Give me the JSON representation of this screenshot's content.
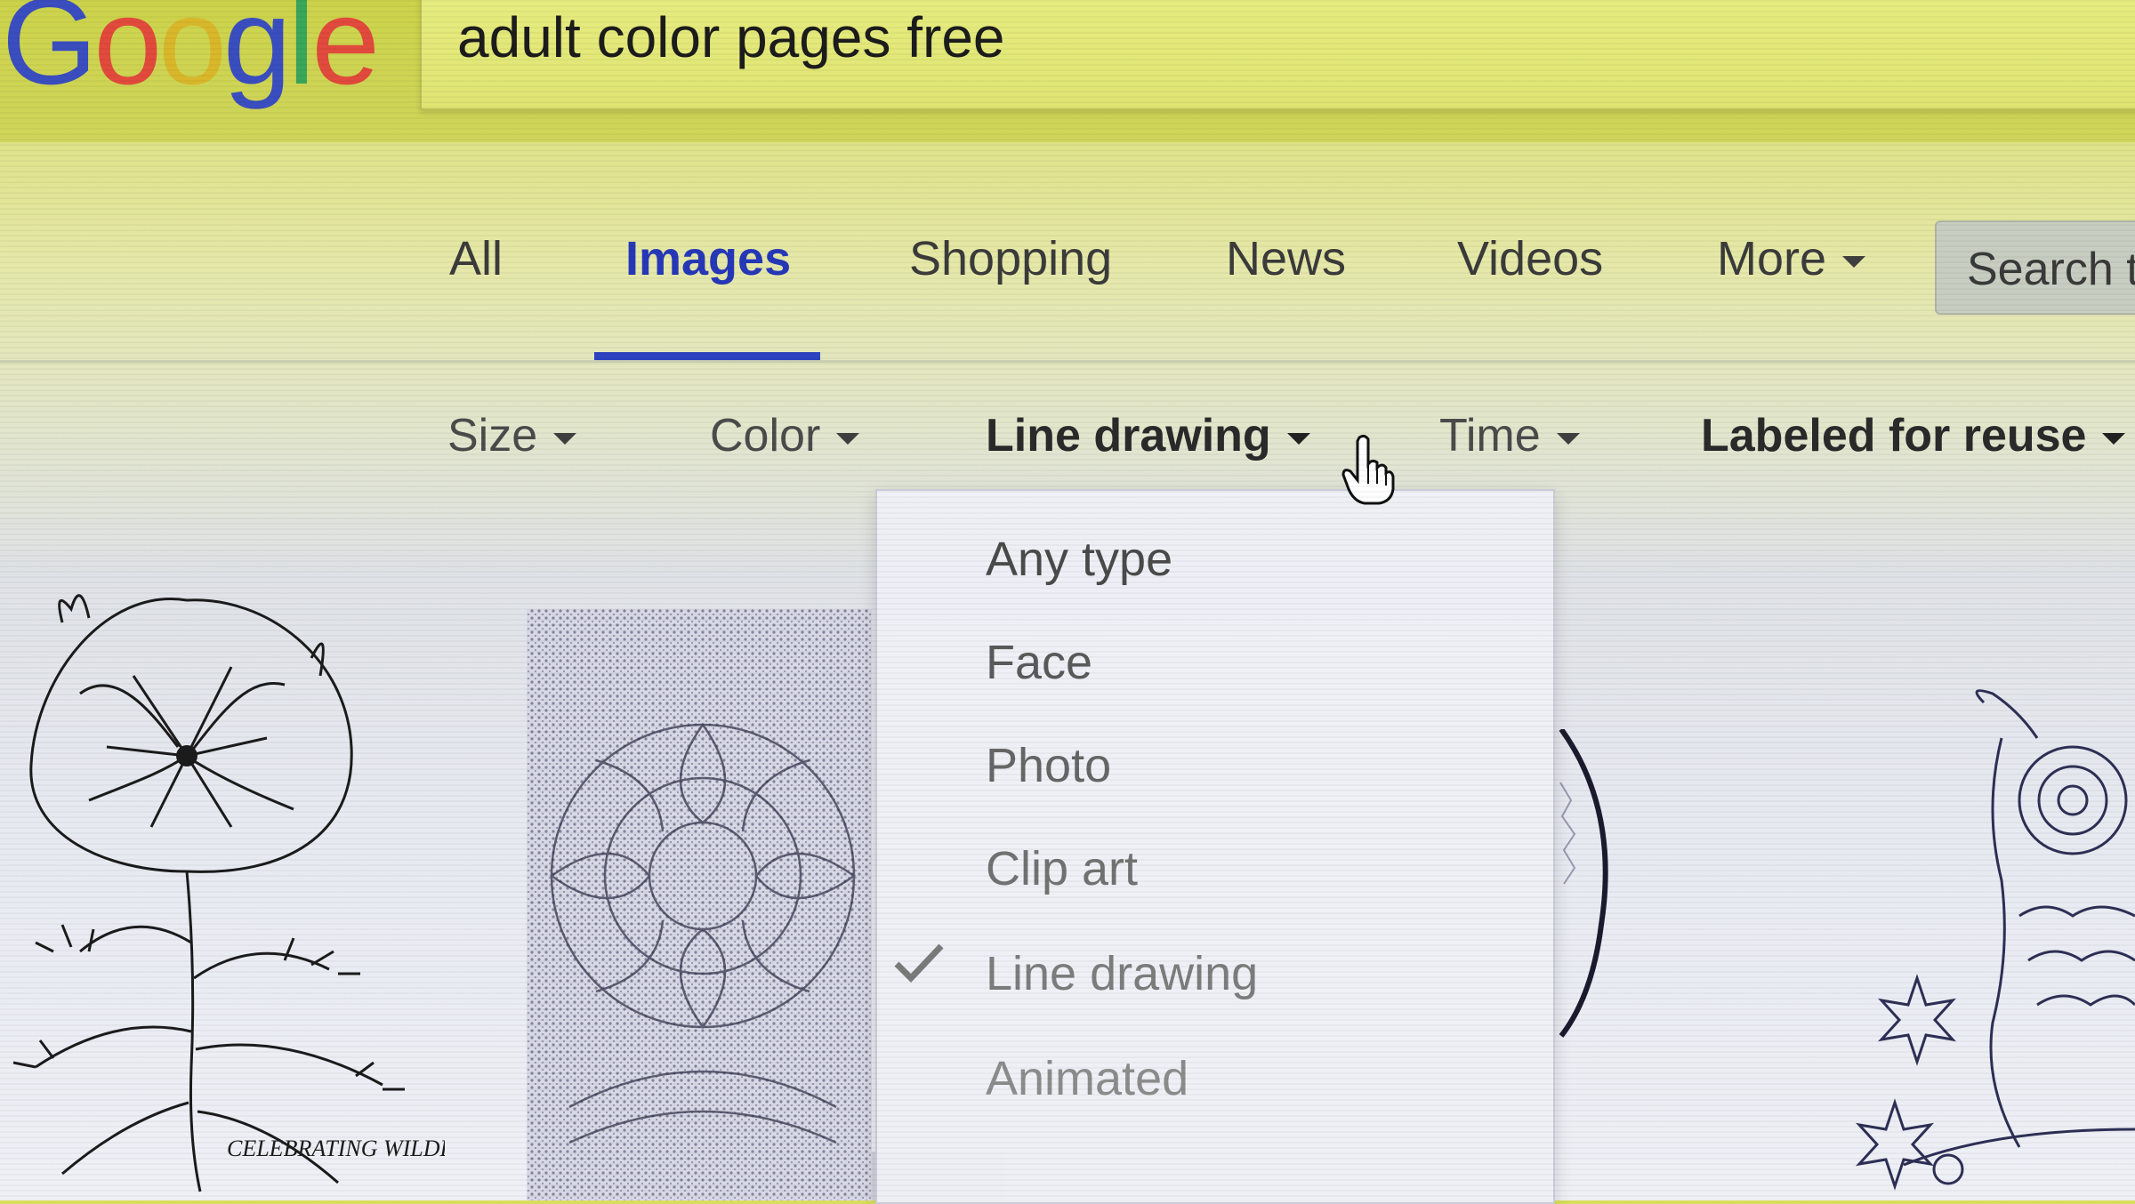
{
  "logo": {
    "letters": [
      "G",
      "o",
      "o",
      "g",
      "l",
      "e"
    ]
  },
  "search": {
    "query": "adult color pages free"
  },
  "tabs": [
    {
      "label": "All"
    },
    {
      "label": "Images",
      "active": true
    },
    {
      "label": "Shopping"
    },
    {
      "label": "News"
    },
    {
      "label": "Videos"
    },
    {
      "label": "More"
    }
  ],
  "search_tools_label": "Search t",
  "filters": {
    "size": "Size",
    "color": "Color",
    "type": "Line drawing",
    "time": "Time",
    "usage": "Labeled for reuse"
  },
  "type_menu": {
    "items": [
      {
        "label": "Any type"
      },
      {
        "label": "Face"
      },
      {
        "label": "Photo"
      },
      {
        "label": "Clip art"
      },
      {
        "label": "Line drawing",
        "checked": true
      },
      {
        "label": "Animated"
      }
    ]
  },
  "thumbnails": {
    "poppy_caption": "CELEBRATING WILDFLOWERS"
  },
  "colors": {
    "accent_blue": "#2638b8",
    "logo_blue": "#3a4ec0",
    "logo_red": "#e14a3c",
    "logo_yellow": "#d9b72a",
    "logo_green": "#3aa65a"
  }
}
